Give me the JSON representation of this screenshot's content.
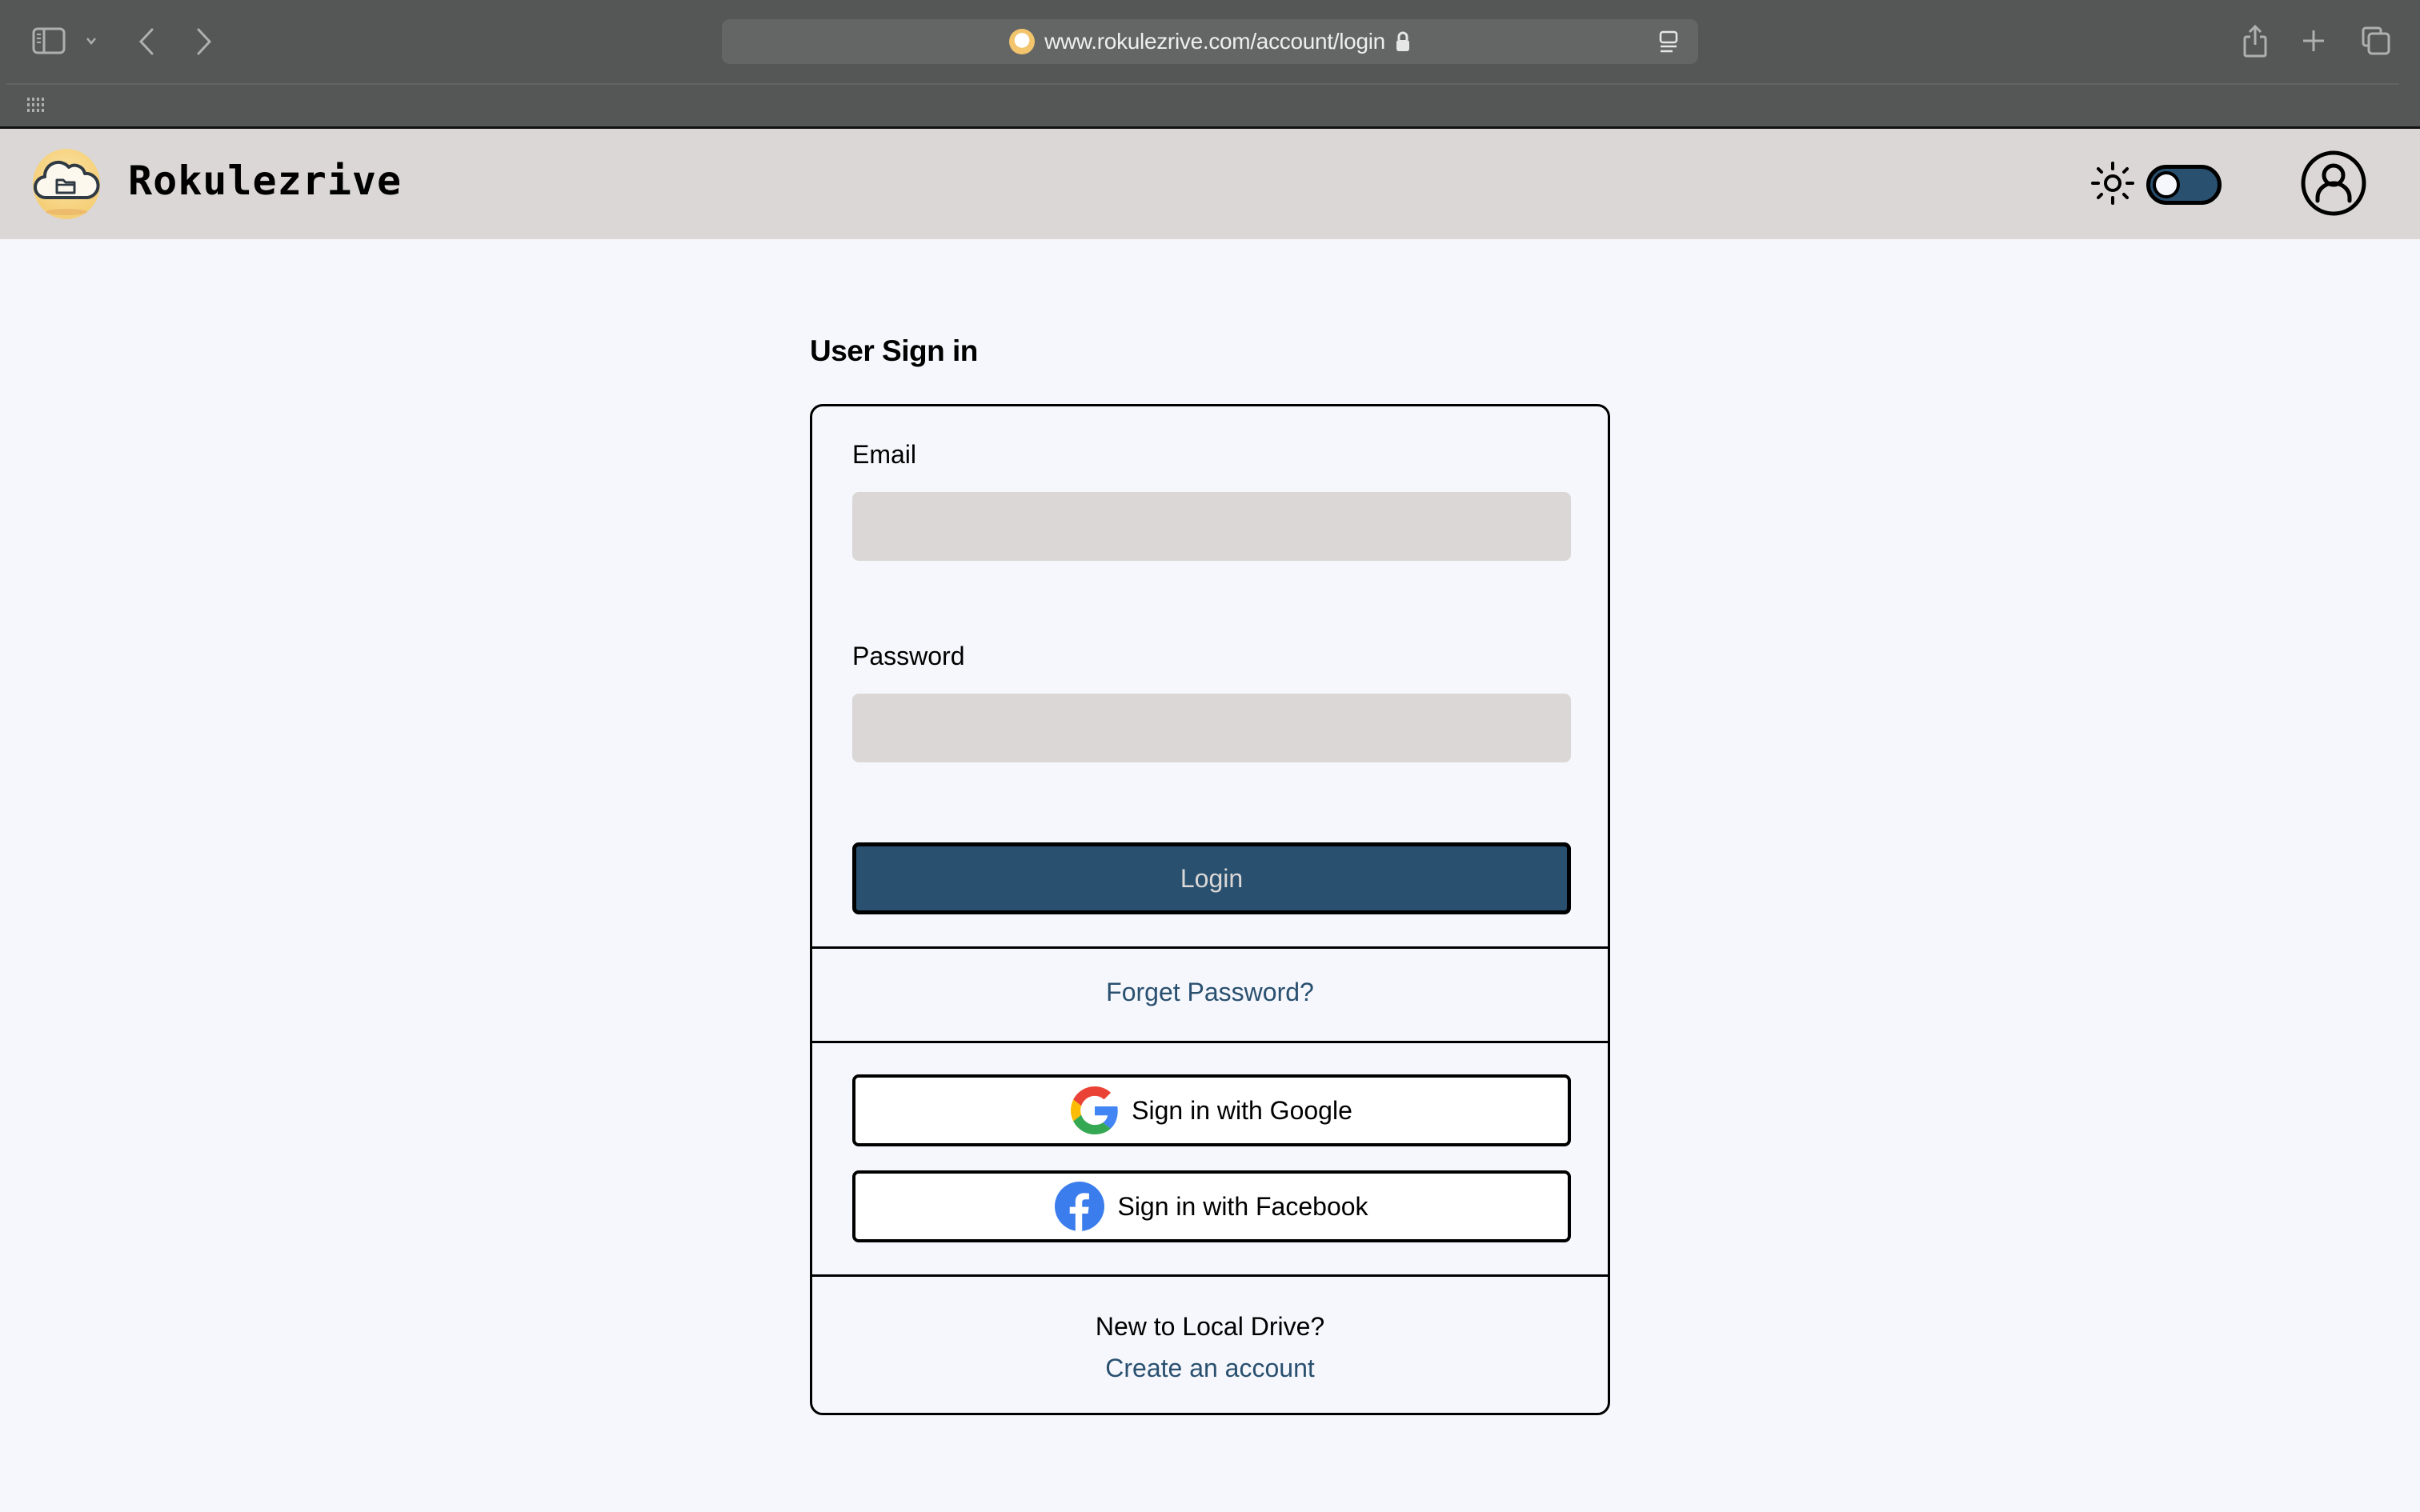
{
  "browser": {
    "url": "www.rokulezrive.com/account/login",
    "icons": [
      "sidebar-icon",
      "chevron-down-icon",
      "back-icon",
      "forward-icon",
      "lock-icon",
      "reader-icon",
      "share-icon",
      "new-tab-icon",
      "tab-overview-icon",
      "apps-grid-icon"
    ]
  },
  "header": {
    "brand": "Rokulezrive",
    "theme_toggle": {
      "state": "light",
      "on": false
    },
    "colors": {
      "header_bg": "#dbd7d6",
      "accent": "#29506f"
    }
  },
  "signin": {
    "title": "User Sign in",
    "email_label": "Email",
    "email_value": "",
    "password_label": "Password",
    "password_value": "",
    "login_label": "Login",
    "forgot_label": "Forget Password?",
    "google_label": "Sign in with Google",
    "facebook_label": "Sign in with Facebook",
    "new_user_text": "New to Local Drive?",
    "create_account_label": "Create an account"
  }
}
